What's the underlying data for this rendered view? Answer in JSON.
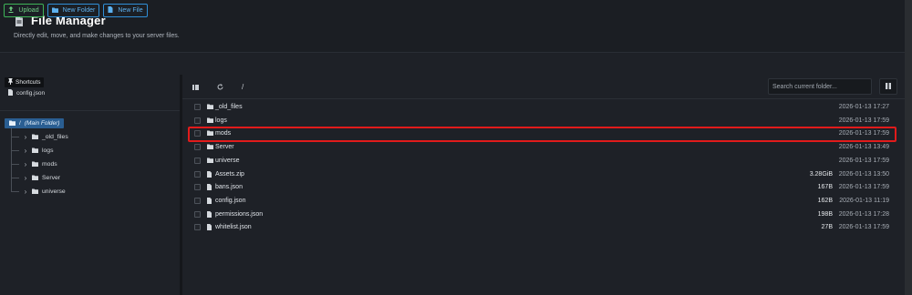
{
  "header": {
    "title": "File Manager",
    "subtitle": "Directly edit, move, and make changes to your server files."
  },
  "toolbar": {
    "upload_label": "Upload",
    "new_folder_label": "New Folder",
    "new_file_label": "New File"
  },
  "sidebar": {
    "shortcuts_label": "Shortcuts",
    "shortcut_items": [
      "config.json"
    ],
    "tree_root_slash": "/",
    "tree_root_label": "(Main Folder)",
    "tree_items": [
      "_old_files",
      "logs",
      "mods",
      "Server",
      "universe"
    ]
  },
  "main": {
    "path": "/",
    "search_placeholder": "Search current folder...",
    "rows": [
      {
        "name": "_old_files",
        "type": "folder",
        "size": "",
        "date": "2026-01-13 17:27"
      },
      {
        "name": "logs",
        "type": "folder",
        "size": "",
        "date": "2026-01-13 17:59"
      },
      {
        "name": "mods",
        "type": "folder",
        "size": "",
        "date": "2026-01-13 17:59"
      },
      {
        "name": "Server",
        "type": "folder",
        "size": "",
        "date": "2026-01-13 13:49"
      },
      {
        "name": "universe",
        "type": "folder",
        "size": "",
        "date": "2026-01-13 17:59"
      },
      {
        "name": "Assets.zip",
        "type": "file",
        "size": "3.28GiB",
        "date": "2026-01-13 13:50"
      },
      {
        "name": "bans.json",
        "type": "file",
        "size": "167B",
        "date": "2026-01-13 17:59"
      },
      {
        "name": "config.json",
        "type": "file",
        "size": "162B",
        "date": "2026-01-13 11:19"
      },
      {
        "name": "permissions.json",
        "type": "file",
        "size": "198B",
        "date": "2026-01-13 17:28"
      },
      {
        "name": "whitelist.json",
        "type": "file",
        "size": "27B",
        "date": "2026-01-13 17:59"
      }
    ]
  },
  "colors": {
    "accent_green": "#3eb357",
    "accent_blue": "#2f8ed6",
    "highlight_red": "#e11b1b",
    "selected_tree": "#2a5e92"
  }
}
